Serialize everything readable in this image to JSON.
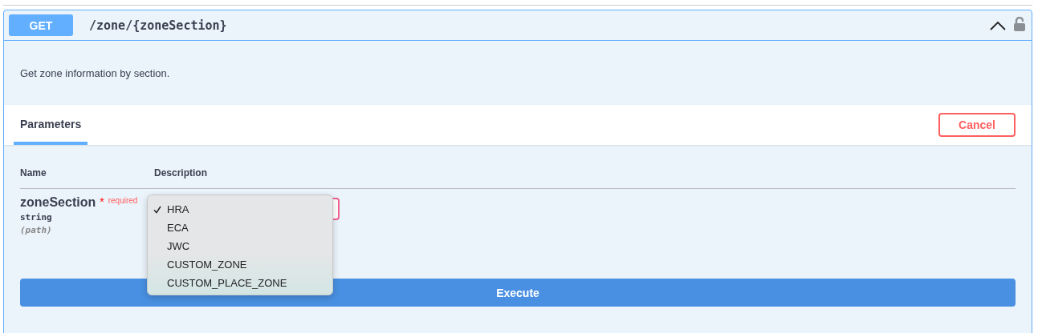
{
  "operation": {
    "method": "GET",
    "path": "/zone/{zoneSection}",
    "expanded": true,
    "locked": false
  },
  "summary": "Get zone information by section.",
  "tabs": [
    {
      "label": "Parameters",
      "selected": true
    }
  ],
  "cancel_button": "Cancel",
  "table": {
    "columns": [
      "Name",
      "Description"
    ],
    "rows": [
      {
        "name": "zoneSection",
        "required_mark": "*",
        "required": "required",
        "type": "string",
        "location": "(path)",
        "options": [
          {
            "label": "HRA",
            "selected": true
          },
          {
            "label": "ECA",
            "selected": false
          },
          {
            "label": "JWC",
            "selected": false
          },
          {
            "label": "CUSTOM_ZONE",
            "selected": false
          },
          {
            "label": "CUSTOM_PLACE_ZONE",
            "selected": false
          }
        ]
      }
    ]
  },
  "execute_button": "Execute"
}
